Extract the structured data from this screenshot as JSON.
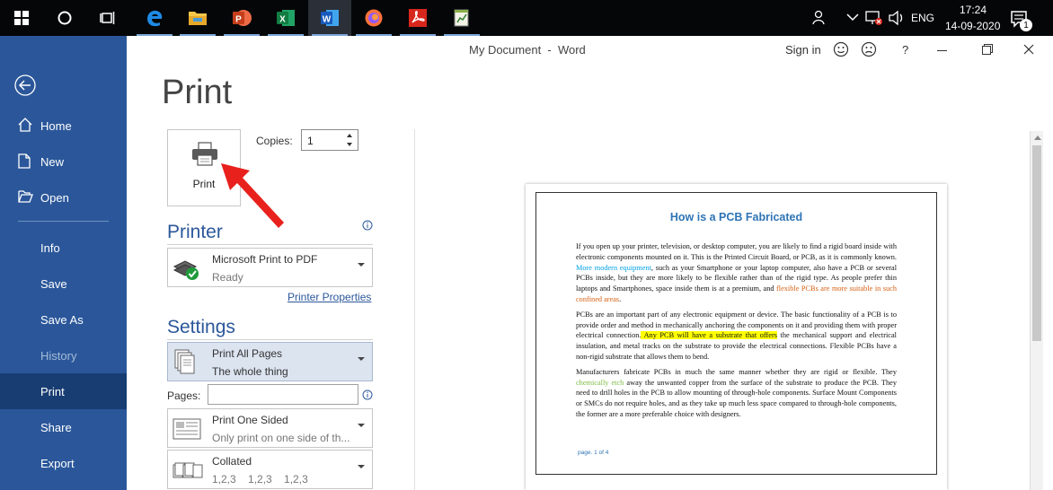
{
  "taskbar": {
    "apps": [
      {
        "name": "edge"
      },
      {
        "name": "file-explorer"
      },
      {
        "name": "powerpoint"
      },
      {
        "name": "excel"
      },
      {
        "name": "word"
      },
      {
        "name": "firefox"
      },
      {
        "name": "acrobat"
      },
      {
        "name": "notepad"
      }
    ],
    "language": "ENG",
    "time": "17:24",
    "date": "14-09-2020",
    "notification_count": "1"
  },
  "window": {
    "title": "My Document  -  Word",
    "sign_in": "Sign in",
    "help": "?"
  },
  "nav": {
    "items": [
      {
        "label": "Home"
      },
      {
        "label": "New"
      },
      {
        "label": "Open"
      },
      {
        "label": "Info"
      },
      {
        "label": "Save"
      },
      {
        "label": "Save As"
      },
      {
        "label": "History"
      },
      {
        "label": "Print"
      },
      {
        "label": "Share"
      },
      {
        "label": "Export"
      }
    ]
  },
  "print": {
    "heading": "Print",
    "button_label": "Print",
    "copies_label": "Copies:",
    "copies_value": "1",
    "printer_heading": "Printer",
    "printer_name": "Microsoft Print to PDF",
    "printer_status": "Ready",
    "printer_properties": "Printer Properties",
    "settings_heading": "Settings",
    "pages_option": "Print All Pages",
    "pages_option_sub": "The whole thing",
    "pages_label": "Pages:",
    "pages_value": "",
    "sided_option": "Print One Sided",
    "sided_option_sub": "Only print on one side of th...",
    "collate_option": "Collated",
    "collate_sub": "1,2,3    1,2,3    1,2,3"
  },
  "preview": {
    "title": "How is a PCB Fabricated",
    "p1a": "If you open up your printer, television, or desktop computer, you are likely to find a rigid board inside with electronic components mounted on it. This is the Printed Circuit Board, or PCB, as it is commonly known. ",
    "p1_link": "More modern equipment",
    "p1b": ", such as your Smartphone or your laptop computer, also have a PCB or several PCBs inside, but they are more likely to be flexible rather than of the rigid type. As people prefer thin laptops and Smartphones, space inside them is at a premium, and ",
    "p1_orange": "flexible PCBs are more suitable in such confined areas",
    "p1c": ".",
    "p2a": "PCBs are an important part of any electronic equipment or device. The basic functionality of a PCB is to provide order and method in mechanically anchoring the components on it and providing them with proper electrical connection.",
    "p2_highlight": " Any PCB will have a substrate that offers",
    "p2b": " the mechanical support and electrical insulation, and metal tracks on the substrate to provide the electrical connections. Flexible PCBs have a non-rigid substrate that allows them to bend.",
    "p3a": "Manufacturers fabricate PCBs in much the same manner whether they are rigid or flexible. They ",
    "p3_green": "chemically etch",
    "p3b": " away the unwanted copper from the surface of the substrate to produce the PCB. They need to drill holes in the PCB to allow mounting of through-hole components. Surface Mount Components or SMCs do not require holes, and as they take up much less space compared to through-hole components, the former are a more preferable choice with designers.",
    "page_footer": "page. 1 of 4"
  },
  "colors": {
    "nav_bg": "#2b579a",
    "nav_selected": "#183d72",
    "accent": "#2b579a",
    "annotation_arrow": "#e8211d"
  }
}
